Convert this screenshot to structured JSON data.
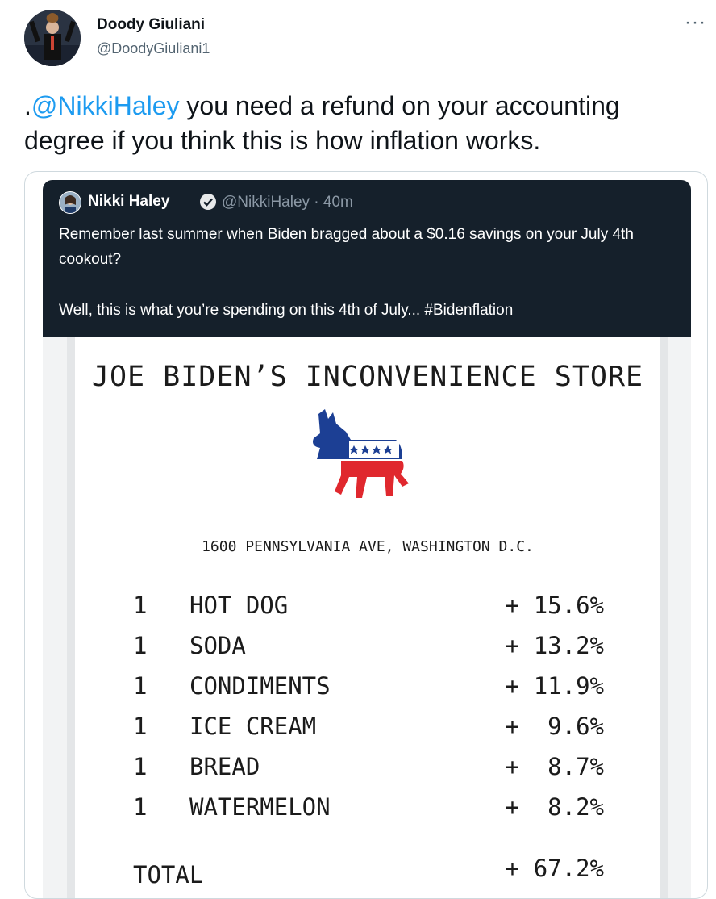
{
  "author": {
    "name": "Doody Giuliani",
    "handle": "@DoodyGiuliani1"
  },
  "tweet": {
    "prefix": ".",
    "mention": "@NikkiHaley",
    "text": " you need a refund on your accounting degree if you think this is how inflation works."
  },
  "quoted": {
    "name": "Nikki Haley",
    "meta": "@NikkiHaley · 40m",
    "line1": "Remember last summer when Biden bragged about a $0.16 savings on your July 4th cookout?",
    "line2": "Well, this is what you’re spending on this 4th of July... #Bidenflation"
  },
  "receipt": {
    "store": "JOE BIDEN’S INCONVENIENCE STORE",
    "address": "1600 PENNSYLVANIA AVE, WASHINGTON D.C.",
    "items": [
      {
        "qty": "1",
        "name": "HOT DOG",
        "price": "+ 15.6%"
      },
      {
        "qty": "1",
        "name": "SODA",
        "price": "+ 13.2%"
      },
      {
        "qty": "1",
        "name": "CONDIMENTS",
        "price": "+ 11.9%"
      },
      {
        "qty": "1",
        "name": "ICE CREAM",
        "price": "+  9.6%"
      },
      {
        "qty": "1",
        "name": "BREAD",
        "price": "+  8.7%"
      },
      {
        "qty": "1",
        "name": "WATERMELON",
        "price": "+  8.2%"
      }
    ],
    "total_label": "TOTAL",
    "total_value": "+ 67.2%"
  },
  "colors": {
    "link": "#1d9bf0",
    "dark_bg": "#15202b",
    "donkey_blue": "#1c3f94",
    "donkey_red": "#e0282e"
  },
  "icons": {
    "more": "more-horizontal-icon",
    "verified": "verified-badge-icon",
    "logo": "democratic-donkey-logo"
  }
}
